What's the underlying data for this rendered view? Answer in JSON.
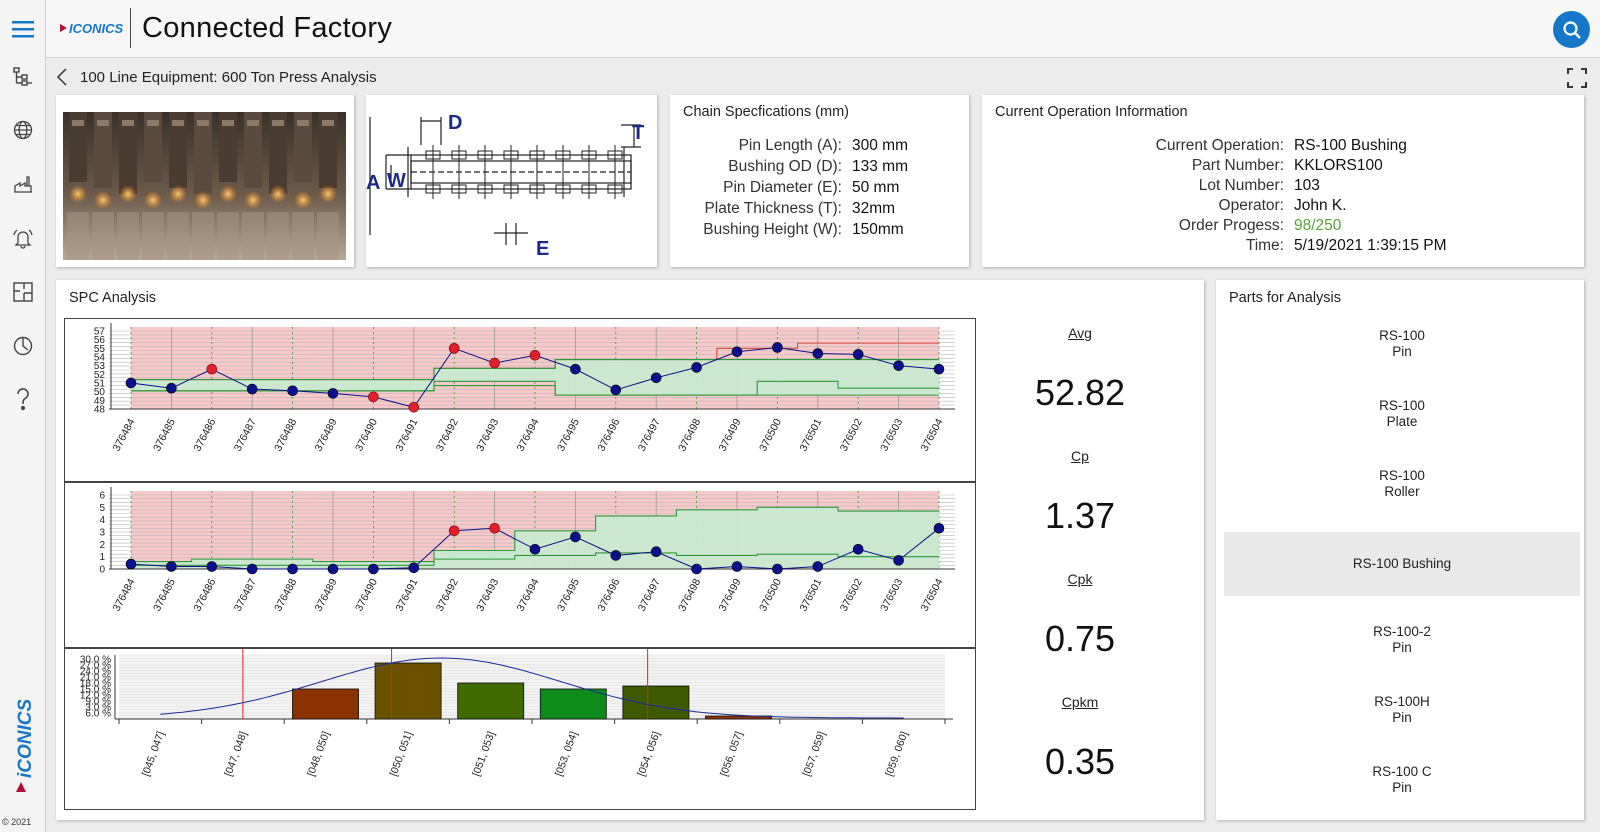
{
  "app": {
    "title": "Connected Factory",
    "logo_text": "ICONICS",
    "copyright": "© 2021"
  },
  "sidebar": {
    "items": [
      {
        "icon": "menu-icon"
      },
      {
        "icon": "hierarchy-icon"
      },
      {
        "icon": "globe-icon"
      },
      {
        "icon": "factory-icon"
      },
      {
        "icon": "alarm-bell-icon"
      },
      {
        "icon": "floorplan-icon"
      },
      {
        "icon": "analytics-clock-icon"
      },
      {
        "icon": "help-icon"
      }
    ],
    "brand_text": "iCONICS"
  },
  "breadcrumb": {
    "text": "100 Line Equipment: 600 Ton Press Analysis"
  },
  "chain_specs": {
    "title": "Chain Specfications (mm)",
    "rows": [
      {
        "label": "Pin Length (A):",
        "value": "300 mm"
      },
      {
        "label": "Bushing OD (D):",
        "value": "133 mm"
      },
      {
        "label": "Pin Diameter (E):",
        "value": "50 mm"
      },
      {
        "label": "Plate Thickness (T):",
        "value": "32mm"
      },
      {
        "label": "Bushing Height (W):",
        "value": "150mm"
      }
    ]
  },
  "diagram": {
    "labels": {
      "D": "D",
      "T": "T",
      "A": "A",
      "W": "W",
      "E": "E"
    }
  },
  "operation": {
    "title": "Current Operation Information",
    "rows": [
      {
        "label": "Current Operation:",
        "value": "RS-100 Bushing"
      },
      {
        "label": "Part Number:",
        "value": "KKLORS100"
      },
      {
        "label": "Lot Number:",
        "value": "103"
      },
      {
        "label": "Operator:",
        "value": "John K."
      },
      {
        "label": "Order Progess:",
        "value": "98/250"
      },
      {
        "label": "Time:",
        "value": "5/19/2021 1:39:15 PM"
      }
    ],
    "progress_color": "#5a9e3a"
  },
  "spc": {
    "title": "SPC Analysis",
    "stats": [
      {
        "label": "Avg",
        "value": "52.82"
      },
      {
        "label": "Cp",
        "value": "1.37"
      },
      {
        "label": "Cpk",
        "value": "0.75"
      },
      {
        "label": "Cpkm",
        "value": "0.35"
      }
    ]
  },
  "parts": {
    "title": "Parts for Analysis",
    "items": [
      {
        "label": "RS-100\nPin",
        "selected": false
      },
      {
        "label": "RS-100\nPlate",
        "selected": false
      },
      {
        "label": "RS-100\nRoller",
        "selected": false
      },
      {
        "label": "RS-100 Bushing",
        "selected": true
      },
      {
        "label": "RS-100-2\nPin",
        "selected": false
      },
      {
        "label": "RS-100H\nPin",
        "selected": false
      },
      {
        "label": "RS-100 C\nPin",
        "selected": false
      }
    ]
  },
  "colors": {
    "accent": "#1677c8",
    "out_of_control_zone": "#f7c9c9",
    "control_band": "#c8ead0",
    "control_line": "#2e9a3a",
    "point": "#0b108c",
    "point_alarm": "#e0202a"
  },
  "chart_data": [
    {
      "type": "line",
      "name": "xbar",
      "categories": [
        "376484",
        "376485",
        "376486",
        "376487",
        "376488",
        "376489",
        "376490",
        "376491",
        "376492",
        "376493",
        "376494",
        "376495",
        "376496",
        "376497",
        "376498",
        "376499",
        "376500",
        "376501",
        "376502",
        "376503",
        "376504"
      ],
      "values": [
        51.0,
        50.4,
        52.6,
        50.3,
        50.1,
        49.8,
        49.4,
        48.2,
        55.0,
        53.3,
        54.2,
        52.6,
        50.2,
        51.6,
        52.8,
        54.6,
        55.1,
        54.4,
        54.3,
        53.0,
        52.6
      ],
      "alarms": [
        false,
        false,
        true,
        false,
        false,
        false,
        true,
        true,
        true,
        true,
        true,
        false,
        false,
        false,
        false,
        false,
        false,
        false,
        false,
        false,
        false
      ],
      "ylim": [
        48,
        57
      ],
      "yticks": [
        48,
        49,
        50,
        51,
        52,
        53,
        54,
        55,
        56,
        57
      ],
      "ytick_labels": [
        "48",
        "49",
        "50",
        "51",
        "52",
        "53",
        "54",
        "55",
        "56",
        "57"
      ],
      "lower_band": [
        50.1,
        50.1,
        50.1,
        50.1,
        50.1,
        50.1,
        50.1,
        50.1,
        51.2,
        51.2,
        51.2,
        49.6,
        49.6,
        49.6,
        49.6,
        49.6,
        49.6,
        49.6,
        49.6,
        49.6,
        49.6
      ],
      "upper_band": [
        51.4,
        51.4,
        51.4,
        51.4,
        51.4,
        51.4,
        51.4,
        51.4,
        52.7,
        52.7,
        52.7,
        53.7,
        53.7,
        53.7,
        53.7,
        53.7,
        53.7,
        53.7,
        53.7,
        53.7,
        53.7
      ],
      "ucl": [
        51.4,
        51.4,
        51.4,
        51.4,
        51.4,
        51.4,
        51.4,
        51.4,
        52.7,
        52.7,
        52.7,
        53.7,
        53.7,
        53.7,
        53.7,
        55.0,
        55.0,
        55.6,
        55.6,
        55.6,
        55.6
      ],
      "lcl": [
        50.1,
        50.1,
        50.1,
        50.1,
        50.1,
        50.1,
        50.1,
        50.1,
        50.7,
        50.7,
        50.7,
        49.6,
        49.6,
        49.6,
        49.6,
        49.6,
        51.2,
        51.2,
        50.4,
        50.4,
        50.4
      ]
    },
    {
      "type": "line",
      "name": "range",
      "categories": [
        "376484",
        "376485",
        "376486",
        "376487",
        "376488",
        "376489",
        "376490",
        "376491",
        "376492",
        "376493",
        "376494",
        "376495",
        "376496",
        "376497",
        "376498",
        "376499",
        "376500",
        "376501",
        "376502",
        "376503",
        "376504"
      ],
      "values": [
        0.4,
        0.2,
        0.2,
        0.0,
        0.0,
        0.0,
        0.0,
        0.1,
        3.1,
        3.3,
        1.6,
        2.6,
        1.1,
        1.4,
        0.0,
        0.2,
        0.0,
        0.2,
        1.6,
        0.7,
        3.3
      ],
      "alarms": [
        false,
        false,
        false,
        false,
        false,
        false,
        false,
        false,
        true,
        true,
        false,
        false,
        false,
        false,
        false,
        false,
        false,
        false,
        false,
        false,
        false
      ],
      "ylim": [
        0,
        6
      ],
      "yticks": [
        0,
        1,
        2,
        3,
        4,
        5,
        6
      ],
      "ytick_labels": [
        "0",
        "1",
        "2",
        "3",
        "4",
        "5",
        "6"
      ],
      "upper_band": [
        0.6,
        0.6,
        0.8,
        0.8,
        0.8,
        0.6,
        0.6,
        0.6,
        1.5,
        1.5,
        3.1,
        3.1,
        4.3,
        4.3,
        4.8,
        4.8,
        5.0,
        5.0,
        4.7,
        4.7,
        4.7
      ],
      "mid_line": [
        0.3,
        0.3,
        0.3,
        0.3,
        0.3,
        0.3,
        0.3,
        0.3,
        0.8,
        0.8,
        1.1,
        1.1,
        1.3,
        1.3,
        1.1,
        1.1,
        1.2,
        1.2,
        1.0,
        1.0,
        1.0
      ]
    },
    {
      "type": "bar",
      "name": "histogram",
      "categories": [
        "[045, 047]",
        "[047, 048]",
        "[048, 050]",
        "[050, 051]",
        "[051, 053]",
        "[053, 054]",
        "[054, 056]",
        "[056, 057]",
        "[057, 059]",
        "[059, 060]"
      ],
      "values": [
        0,
        0,
        15.0,
        28.0,
        18.0,
        15.0,
        16.5,
        1.5,
        0,
        0
      ],
      "bar_colors": [
        "#8a3300",
        "#8a3300",
        "#8a3300",
        "#6b5200",
        "#3e6a00",
        "#0e8a1a",
        "#3e5a00",
        "#8a3300",
        "#8a3300",
        "#8a3300"
      ],
      "ylim": [
        0,
        32
      ],
      "yticks": [
        3,
        6,
        9,
        12,
        15,
        18,
        21,
        24,
        27,
        30
      ],
      "ytick_labels": [
        "6.0 %",
        "3.0 %",
        "9.0 %",
        "12.0 %",
        "15.0 %",
        "18.0 %",
        "21.0 %",
        "24.0 %",
        "27.0 %",
        "30.0 %"
      ],
      "spec_lines": [
        1.5,
        3.3,
        6.4
      ],
      "normal_curve": {
        "mean": 3.9,
        "sd": 1.45,
        "peak": 30.0
      }
    }
  ]
}
